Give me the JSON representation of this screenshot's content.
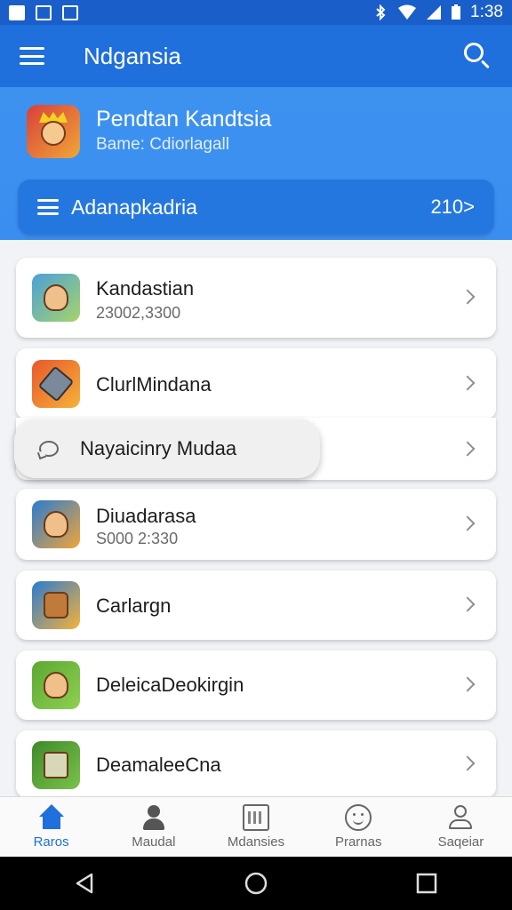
{
  "status_bar": {
    "time": "1:38"
  },
  "app_bar": {
    "title": "Ndgansia"
  },
  "profile": {
    "name": "Pendtan Kandtsia",
    "subtitle": "Bame: Cdiorlagall"
  },
  "section": {
    "title": "Adanapkadria",
    "count": "210>"
  },
  "list": [
    {
      "title": "Kandastian",
      "subtitle": "23002,3300",
      "colors": [
        "#4aa0d8",
        "#a6d46a"
      ]
    },
    {
      "title": "ClurlMindana",
      "subtitle": "",
      "colors": [
        "#e8572a",
        "#f5b23a"
      ]
    },
    {
      "title": "",
      "subtitle": "",
      "colors": []
    },
    {
      "title": "Diuadarasa",
      "subtitle": "S000 2:330",
      "colors": [
        "#2b7bd0",
        "#f0a638"
      ]
    },
    {
      "title": "Carlargn",
      "subtitle": "",
      "colors": [
        "#2b7bd0",
        "#f5b23a"
      ]
    },
    {
      "title": "DeleicaDeokirgin",
      "subtitle": "",
      "colors": [
        "#5aa832",
        "#8fd050"
      ]
    },
    {
      "title": "DeamaleeCna",
      "subtitle": "",
      "colors": [
        "#3e8a2a",
        "#7ac24a"
      ]
    }
  ],
  "tooltip": {
    "text": "Nayaicinry Mudaa"
  },
  "bottom_nav": [
    {
      "label": "Raros",
      "icon": "home-icon",
      "active": true
    },
    {
      "label": "Maudal",
      "icon": "user-icon",
      "active": false
    },
    {
      "label": "Mdansies",
      "icon": "calendar-icon",
      "active": false
    },
    {
      "label": "Prarnas",
      "icon": "smile-icon",
      "active": false
    },
    {
      "label": "Saqeiar",
      "icon": "person-icon",
      "active": false
    }
  ],
  "colors": {
    "primary": "#1f6fdc",
    "header": "#3a8eef"
  }
}
